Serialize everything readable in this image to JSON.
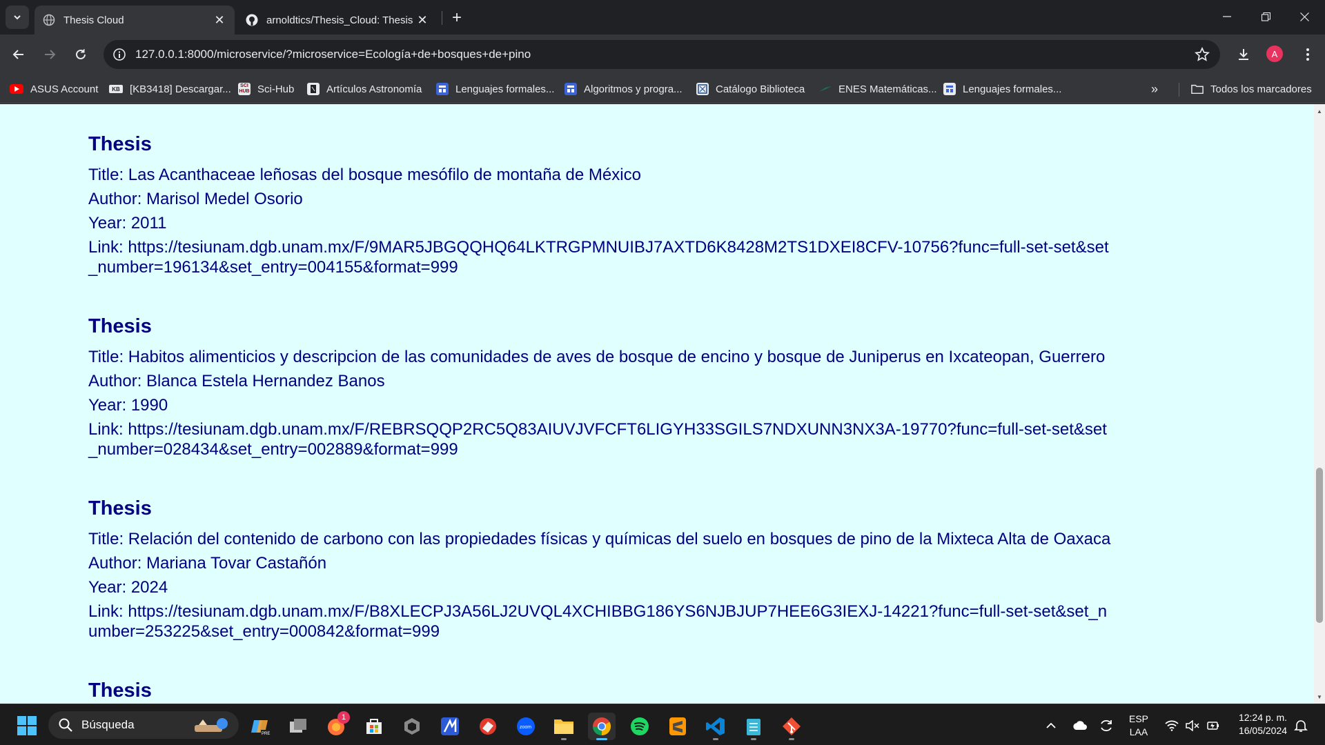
{
  "browser": {
    "tabs": [
      {
        "title": "Thesis Cloud",
        "active": true
      },
      {
        "title": "arnoldtics/Thesis_Cloud: Thesis",
        "active": false
      }
    ],
    "address_url": "127.0.0.1:8000/microservice/?microservice=Ecología+de+bosques+de+pino",
    "profile_initial": "A",
    "profile_color": "#e8335f"
  },
  "bookmarks": {
    "items": [
      {
        "label": "ASUS Account",
        "icon": "youtube-icon"
      },
      {
        "label": "[KB3418] Descargar...",
        "icon": "kb-icon"
      },
      {
        "label": "Sci-Hub",
        "icon": "scihub-icon"
      },
      {
        "label": "Artículos Astronomía",
        "icon": "bookmark-page-icon"
      },
      {
        "label": "Lenguajes formales...",
        "icon": "site-icon"
      },
      {
        "label": "Algoritmos y progra...",
        "icon": "site-icon"
      },
      {
        "label": "Catálogo Biblioteca",
        "icon": "library-icon"
      },
      {
        "label": "ENES Matemáticas...",
        "icon": "enes-icon"
      },
      {
        "label": "Lenguajes formales...",
        "icon": "site-icon"
      }
    ],
    "all_bookmarks_label": "Todos los marcadores"
  },
  "page": {
    "background_color": "#e0ffff",
    "text_color": "#000080",
    "entries": [
      {
        "heading": "Thesis",
        "title": "Title: Las Acanthaceae leñosas del bosque mesófilo de montaña de México",
        "author": "Author: Marisol Medel Osorio",
        "year": "Year: 2011",
        "link": "Link: https://tesiunam.dgb.unam.mx/F/9MAR5JBGQQHQ64LKTRGPMNUIBJ7AXTD6K8428M2TS1DXEI8CFV-10756?func=full-set-set&set_number=196134&set_entry=004155&format=999"
      },
      {
        "heading": "Thesis",
        "title": "Title: Habitos alimenticios y descripcion de las comunidades de aves de bosque de encino y bosque de Juniperus en Ixcateopan, Guerrero",
        "author": "Author: Blanca Estela Hernandez Banos",
        "year": "Year: 1990",
        "link": "Link: https://tesiunam.dgb.unam.mx/F/REBRSQQP2RC5Q83AIUVJVFCFT6LIGYH33SGILS7NDXUNN3NX3A-19770?func=full-set-set&set_number=028434&set_entry=002889&format=999"
      },
      {
        "heading": "Thesis",
        "title": "Title: Relación del contenido de carbono con las propiedades físicas y químicas del suelo en bosques de pino de la Mixteca Alta de Oaxaca",
        "author": "Author: Mariana Tovar Castañón",
        "year": "Year: 2024",
        "link": "Link: https://tesiunam.dgb.unam.mx/F/B8XLECPJ3A56LJ2UVQL4XCHIBBG186YS6NJBJUP7HEE6G3IEXJ-14221?func=full-set-set&set_number=253225&set_entry=000842&format=999"
      },
      {
        "heading": "Thesis"
      }
    ]
  },
  "taskbar": {
    "search_placeholder": "Búsqueda",
    "notification_badge": "1",
    "language_line1": "ESP",
    "language_line2": "LAA",
    "time": "12:24 p. m.",
    "date": "16/05/2024",
    "apps": [
      "copilot-icon",
      "task-view-icon",
      "firefox-icon",
      "microsoft-store-icon",
      "unity-icon",
      "app-blue-icon",
      "ccleaner-icon",
      "zoom-icon",
      "file-explorer-icon",
      "chrome-icon",
      "spotify-icon",
      "sublime-text-icon",
      "vscode-icon",
      "notepad-icon",
      "git-icon"
    ]
  }
}
